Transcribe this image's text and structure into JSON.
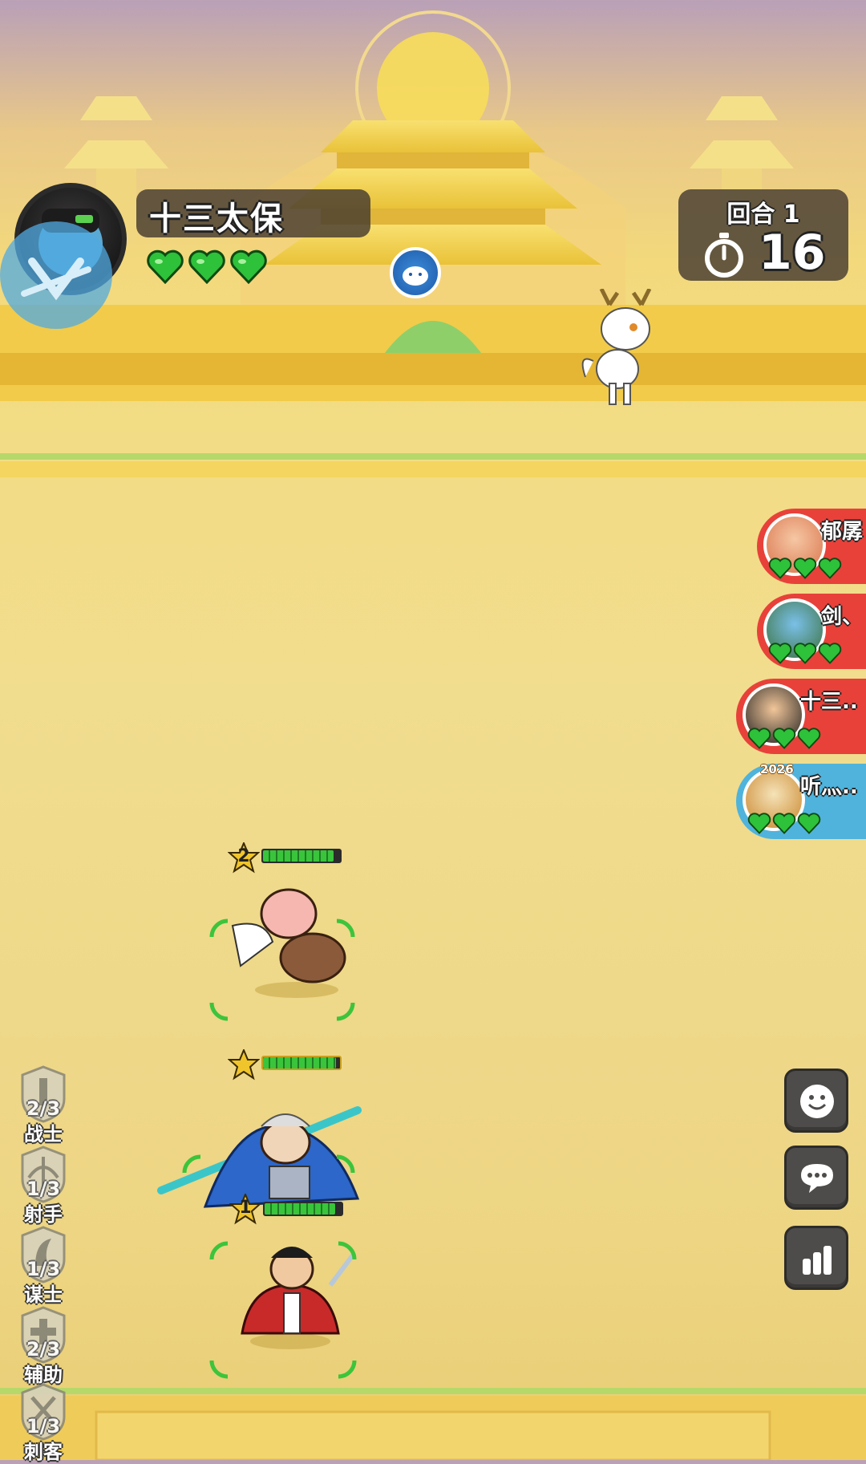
{
  "player": {
    "name": "十三太保",
    "hearts": 3
  },
  "round": {
    "label": "回合 1",
    "timer": "16"
  },
  "opponents": [
    {
      "name": "郁孱",
      "hearts": 3,
      "color": "#e8413a",
      "tag": ""
    },
    {
      "name": "剑、",
      "hearts": 3,
      "color": "#e8413a",
      "tag": ""
    },
    {
      "name": "十三..",
      "hearts": 3,
      "color": "#e8413a",
      "tag": ""
    },
    {
      "name": "听灬..",
      "hearts": 3,
      "color": "#4fb3dc",
      "tag": "2026"
    }
  ],
  "units": [
    {
      "name": "pig-warrior",
      "level": "2",
      "hp": 0.92
    },
    {
      "name": "general",
      "level": "",
      "hp": 0.95
    },
    {
      "name": "swordsman",
      "level": "1",
      "hp": 0.92
    }
  ],
  "classes": [
    {
      "count": "2/3",
      "label": "战士",
      "icon": "warrior-icon"
    },
    {
      "count": "1/3",
      "label": "射手",
      "icon": "archer-icon"
    },
    {
      "count": "1/3",
      "label": "谋士",
      "icon": "strategist-icon"
    },
    {
      "count": "2/3",
      "label": "辅助",
      "icon": "support-icon"
    },
    {
      "count": "1/3",
      "label": "刺客",
      "icon": "assassin-icon"
    }
  ],
  "side_buttons": [
    "emoji-icon",
    "chat-icon",
    "stats-icon"
  ],
  "colors": {
    "heart": "#2ec13a",
    "panel": "#4b4134",
    "accent": "#f0c52c"
  }
}
